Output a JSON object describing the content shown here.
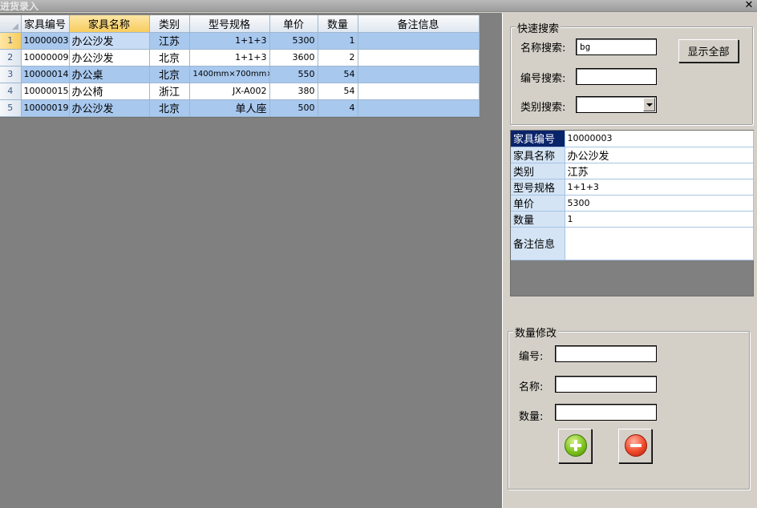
{
  "window": {
    "title": "进货录入",
    "close_glyph": "✕"
  },
  "grid": {
    "columns": [
      "家具编号",
      "家具名称",
      "类别",
      "型号规格",
      "单价",
      "数量",
      "备注信息"
    ],
    "selected_column_index": 1,
    "rows": [
      {
        "num": "1",
        "id": "10000003",
        "name": "办公沙发",
        "category": "江苏",
        "spec": "1+1+3",
        "price": "5300",
        "qty": "1",
        "note": ""
      },
      {
        "num": "2",
        "id": "10000009",
        "name": "办公沙发",
        "category": "北京",
        "spec": "1+1+3",
        "price": "3600",
        "qty": "2",
        "note": ""
      },
      {
        "num": "3",
        "id": "10000014",
        "name": "办公桌",
        "category": "北京",
        "spec": "1400mm×700mm×",
        "price": "550",
        "qty": "54",
        "note": ""
      },
      {
        "num": "4",
        "id": "10000015",
        "name": "办公椅",
        "category": "浙江",
        "spec": "JX-A002",
        "price": "380",
        "qty": "54",
        "note": ""
      },
      {
        "num": "5",
        "id": "10000019",
        "name": "办公沙发",
        "category": "北京",
        "spec": "单人座",
        "price": "500",
        "qty": "4",
        "note": ""
      }
    ]
  },
  "quick_search": {
    "title": "快速搜索",
    "name_label": "名称搜索:",
    "name_value": "bg",
    "code_label": "编号搜索:",
    "code_value": "",
    "category_label": "类别搜索:",
    "category_value": "",
    "show_all_label": "显示全部"
  },
  "details": {
    "rows": [
      {
        "key": "家具编号",
        "value": "10000003"
      },
      {
        "key": "家具名称",
        "value": "办公沙发"
      },
      {
        "key": "类别",
        "value": "江苏"
      },
      {
        "key": "型号规格",
        "value": "1+1+3"
      },
      {
        "key": "单价",
        "value": "5300"
      },
      {
        "key": "数量",
        "value": "1"
      },
      {
        "key": "备注信息",
        "value": ""
      }
    ]
  },
  "qty_edit": {
    "title": "数量修改",
    "code_label": "编号:",
    "code_value": "",
    "name_label": "名称:",
    "name_value": "",
    "qty_label": "数量:",
    "qty_value": "",
    "add_icon": "plus-circle-icon",
    "remove_icon": "minus-circle-icon"
  },
  "colors": {
    "row_alt": "#a8c8ee",
    "header_selected": "#f8cd5e",
    "detail_key_active": "#0a246a",
    "workspace": "#808080",
    "panel": "#d4d0c8"
  }
}
